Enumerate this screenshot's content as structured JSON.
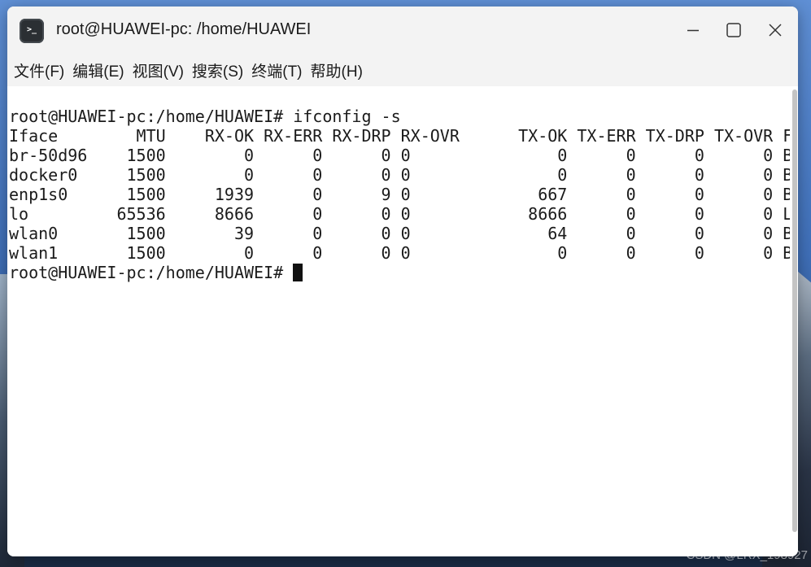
{
  "window": {
    "title": "root@HUAWEI-pc: /home/HUAWEI",
    "app_icon_glyph": ">_",
    "icon": "terminal-icon"
  },
  "menu": {
    "items": [
      {
        "label": "文件(F)"
      },
      {
        "label": "编辑(E)"
      },
      {
        "label": "视图(V)"
      },
      {
        "label": "搜索(S)"
      },
      {
        "label": "终端(T)"
      },
      {
        "label": "帮助(H)"
      }
    ]
  },
  "terminal": {
    "prompt": "root@HUAWEI-pc:/home/HUAWEI# ",
    "command": "ifconfig -s",
    "header": [
      "Iface",
      "MTU",
      "RX-OK",
      "RX-ERR",
      "RX-DRP",
      "RX-OVR",
      "TX-OK",
      "TX-ERR",
      "TX-DRP",
      "TX-OVR",
      "Flg"
    ],
    "rows": [
      [
        "br-50d96",
        "1500",
        "0",
        "0",
        "0",
        "0",
        "0",
        "0",
        "0",
        "0",
        "BMU"
      ],
      [
        "docker0",
        "1500",
        "0",
        "0",
        "0",
        "0",
        "0",
        "0",
        "0",
        "0",
        "BMU"
      ],
      [
        "enp1s0",
        "1500",
        "1939",
        "0",
        "9",
        "0",
        "667",
        "0",
        "0",
        "0",
        "BMU"
      ],
      [
        "lo",
        "65536",
        "8666",
        "0",
        "0",
        "0",
        "8666",
        "0",
        "0",
        "0",
        "LRU"
      ],
      [
        "wlan0",
        "1500",
        "39",
        "0",
        "0",
        "0",
        "64",
        "0",
        "0",
        "0",
        "BMRU"
      ],
      [
        "wlan1",
        "1500",
        "0",
        "0",
        "0",
        "0",
        "0",
        "0",
        "0",
        "0",
        "BMU"
      ]
    ]
  },
  "watermark": "CSDN @LRX_198927",
  "colors": {
    "titlebar_bg": "#f3f3f3",
    "terminal_bg": "#ffffff",
    "terminal_fg": "#1b1b1b",
    "desktop_bg": "#3f6fb8"
  }
}
